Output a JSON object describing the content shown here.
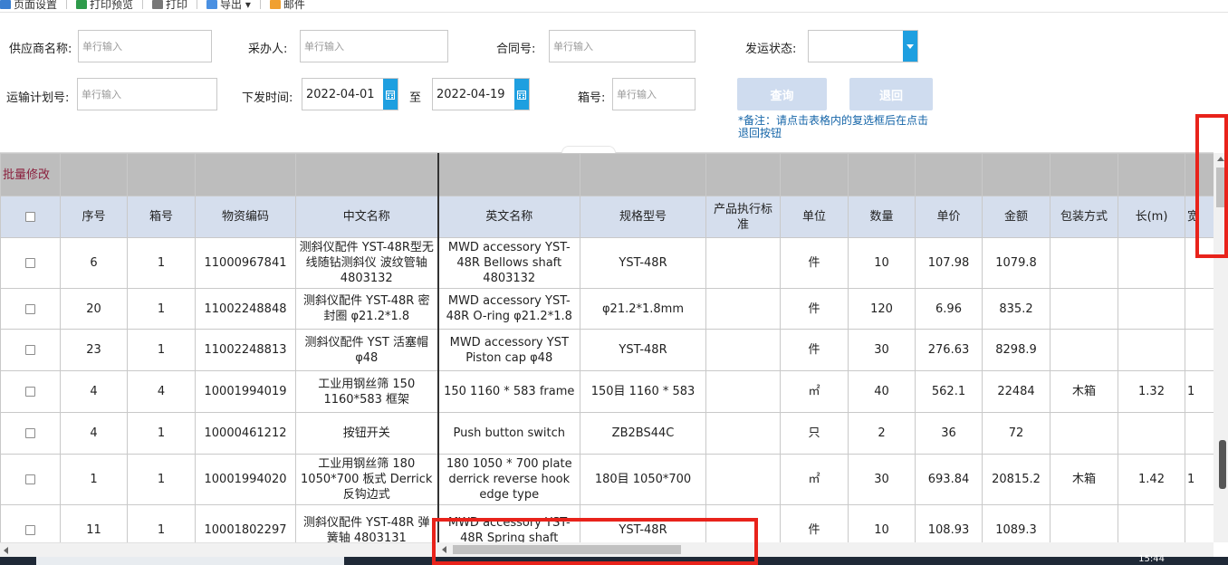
{
  "toolbar": {
    "items": [
      {
        "label": "页面设置",
        "icon": "page-setup-icon"
      },
      {
        "label": "打印预览",
        "icon": "print-preview-icon"
      },
      {
        "label": "打印",
        "icon": "printer-icon"
      },
      {
        "label": "导出 ▾",
        "icon": "export-icon"
      },
      {
        "label": "邮件",
        "icon": "mail-icon"
      }
    ]
  },
  "filters": {
    "supplier_label": "供应商名称:",
    "supplier_placeholder": "单行输入",
    "buyer_label": "采办人:",
    "buyer_placeholder": "单行输入",
    "contract_label": "合同号:",
    "contract_placeholder": "单行输入",
    "ship_status_label": "发运状态:",
    "ship_status_value": "",
    "transport_label": "运输计划号:",
    "transport_placeholder": "单行输入",
    "issue_time_label": "下发时间:",
    "date_from": "2022-04-01",
    "date_sep": "至",
    "date_to": "2022-04-19",
    "box_label": "箱号:",
    "box_placeholder": "单行输入",
    "query_button": "查询",
    "return_button": "退回",
    "note": "*备注：请点击表格内的复选框后在点击退回按钮"
  },
  "table": {
    "bulk_edit": "批量修改",
    "headers": [
      "",
      "序号",
      "箱号",
      "物资编码",
      "中文名称",
      "英文名称",
      "规格型号",
      "产品执行标准",
      "单位",
      "数量",
      "单价",
      "金额",
      "包装方式",
      "长(m)",
      "宽"
    ],
    "rows": [
      [
        "",
        "6",
        "1",
        "11000967841",
        "测斜仪配件 YST-48R型无线随钻测斜仪 波纹管轴 4803132",
        "MWD accessory YST-48R Bellows shaft 4803132",
        "YST-48R",
        "",
        "件",
        "10",
        "107.98",
        "1079.8",
        "",
        "",
        ""
      ],
      [
        "",
        "20",
        "1",
        "11002248848",
        "测斜仪配件 YST-48R 密封圈 φ21.2*1.8",
        "MWD accessory YST-48R O-ring φ21.2*1.8",
        "φ21.2*1.8mm",
        "",
        "件",
        "120",
        "6.96",
        "835.2",
        "",
        "",
        ""
      ],
      [
        "",
        "23",
        "1",
        "11002248813",
        "测斜仪配件 YST 活塞帽 φ48",
        "MWD accessory YST Piston cap φ48",
        "YST-48R",
        "",
        "件",
        "30",
        "276.63",
        "8298.9",
        "",
        "",
        ""
      ],
      [
        "",
        "4",
        "4",
        "10001994019",
        "工业用钢丝筛 150 1160*583 框架",
        "150 1160 * 583 frame",
        "150目 1160 * 583",
        "",
        "㎡",
        "40",
        "562.1",
        "22484",
        "木箱",
        "1.32",
        "1"
      ],
      [
        "",
        "4",
        "1",
        "10000461212",
        "按钮开关",
        "Push button switch",
        "ZB2BS44C",
        "",
        "只",
        "2",
        "36",
        "72",
        "",
        "",
        ""
      ],
      [
        "",
        "1",
        "1",
        "10001994020",
        "工业用钢丝筛 180 1050*700 板式 Derrick反钩边式",
        "180 1050 * 700 plate derrick reverse hook edge type",
        "180目 1050*700",
        "",
        "㎡",
        "30",
        "693.84",
        "20815.2",
        "木箱",
        "1.42",
        "1"
      ],
      [
        "",
        "11",
        "1",
        "10001802297",
        "测斜仪配件 YST-48R 弹簧轴 4803131",
        "MWD accessory YST-48R Spring shaft",
        "YST-48R",
        "",
        "件",
        "10",
        "108.93",
        "1089.3",
        "",
        "",
        ""
      ]
    ]
  },
  "taskbar": {
    "clock": "15:44"
  },
  "colors": {
    "accent": "#1e9fe0",
    "header_bg": "#d5deed",
    "annotation": "#e8231b",
    "note": "#1565a8"
  }
}
